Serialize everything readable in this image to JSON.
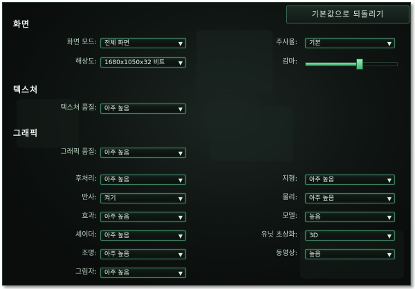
{
  "reset_button": "기본값으로 되돌리기",
  "sections": {
    "screen": "화면",
    "texture": "텍스처",
    "graphics": "그래픽"
  },
  "screen": {
    "mode_label": "화면 모드:",
    "mode_value": "전체 화면",
    "resolution_label": "해상도:",
    "resolution_value": "1680x1050x32 비트",
    "refresh_label": "주사율:",
    "refresh_value": "기본",
    "gamma_label": "감마:",
    "gamma_level": 0.58
  },
  "texture": {
    "quality_label": "텍스처 품질:",
    "quality_value": "아주 높음"
  },
  "graphics": {
    "quality_label": "그래픽 품질:",
    "quality_value": "아주 높음",
    "left": [
      {
        "label": "후처리:",
        "value": "아주 높음"
      },
      {
        "label": "반사:",
        "value": "켜기"
      },
      {
        "label": "효과:",
        "value": "아주 높음"
      },
      {
        "label": "셰이더:",
        "value": "아주 높음"
      },
      {
        "label": "조명:",
        "value": "아주 높음"
      },
      {
        "label": "그림자:",
        "value": "아주 높음"
      }
    ],
    "right": [
      {
        "label": "지형:",
        "value": "아주 높음"
      },
      {
        "label": "물리:",
        "value": "아주 높음"
      },
      {
        "label": "모델:",
        "value": "높음"
      },
      {
        "label": "유닛 초상화:",
        "value": "3D"
      },
      {
        "label": "동영상:",
        "value": "높음"
      }
    ]
  },
  "icons": {
    "dropdown": "chevron-down-icon"
  }
}
